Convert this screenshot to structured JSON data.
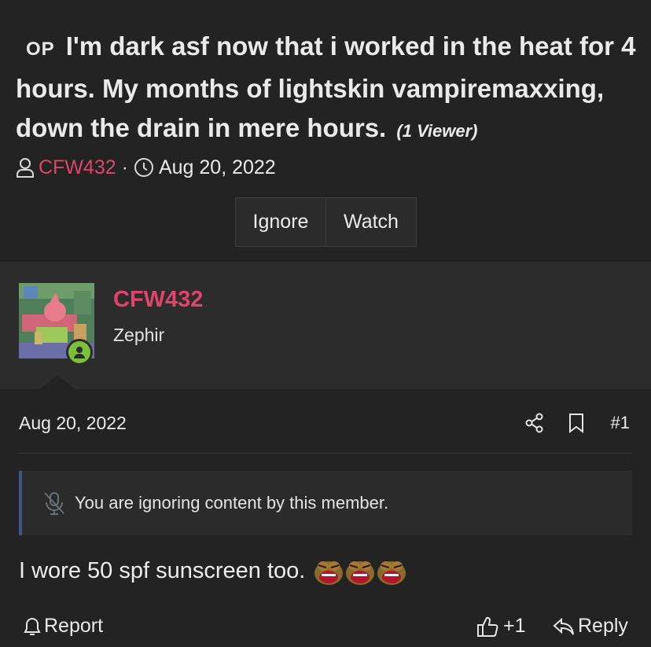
{
  "thread": {
    "op_label": "OP",
    "title": "I'm dark asf now that i worked in the heat for 4 hours. My months of lightskin vampiremaxxing, down the drain in mere hours.",
    "viewer_count": "(1 Viewer)",
    "author": "CFW432",
    "separator": "·",
    "date": "Aug 20, 2022",
    "buttons": {
      "ignore": "Ignore",
      "watch": "Watch"
    }
  },
  "post": {
    "username": "CFW432",
    "user_title": "Zephir",
    "date": "Aug 20, 2022",
    "number": "#1",
    "ignored_notice": "You are ignoring content by this member.",
    "body_text": "I wore 50 spf sunscreen too.",
    "emote_count": 3,
    "actions": {
      "report": "Report",
      "like_count": "+1",
      "reply": "Reply"
    }
  },
  "colors": {
    "background": "#232323",
    "user_block": "#2c2c2c",
    "accent_username": "#e0446d",
    "online_status": "#7bbf3a",
    "notice_border": "#3e5586"
  },
  "icons": {
    "author": "user-icon",
    "date": "clock-icon",
    "share": "share-icon",
    "bookmark": "bookmark-icon",
    "ignored": "muted-microphone-icon",
    "report": "bell-icon",
    "like": "thumbs-up-icon",
    "reply": "reply-arrow-icon"
  }
}
